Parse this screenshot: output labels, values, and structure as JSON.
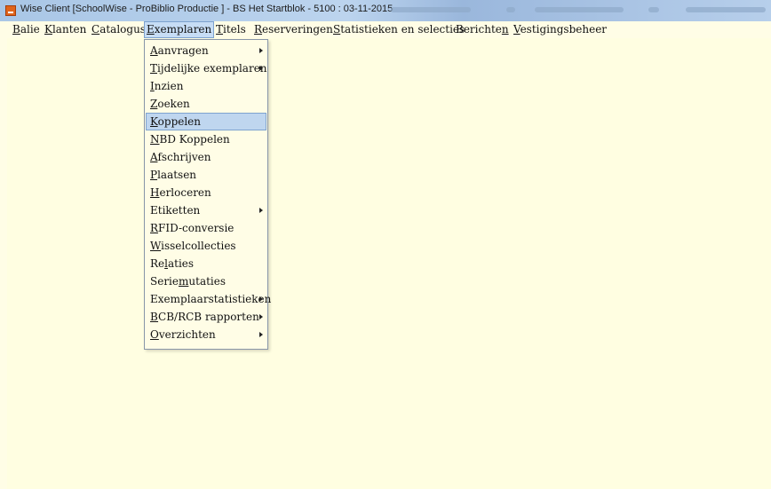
{
  "window": {
    "title": "Wise Client [SchoolWise - ProBiblio Productie ] - BS Het Startblok - 5100 : 03-11-2015"
  },
  "menubar": [
    {
      "label": "Balie",
      "key": "B",
      "rest": "alie"
    },
    {
      "label": "Klanten",
      "key": "K",
      "rest": "lanten"
    },
    {
      "label": "Catalogus",
      "key": "C",
      "rest": "atalogus"
    },
    {
      "label": "Exemplaren",
      "key": "E",
      "rest": "xemplaren",
      "active": true
    },
    {
      "label": "Titels",
      "key": "T",
      "rest": "itels"
    },
    {
      "label": "Reserveringen",
      "key": "R",
      "rest": "eserveringen"
    },
    {
      "label": "Statistieken en selecties",
      "key": "S",
      "rest": "tatistieken en selecties"
    },
    {
      "label": "Berichten",
      "pre": "Berichte",
      "key": "n",
      "rest": ""
    },
    {
      "label": "Vestigingsbeheer",
      "key": "V",
      "rest": "estigingsbeheer"
    }
  ],
  "dropdown": [
    {
      "label": "Aanvragen",
      "pre": "",
      "key": "A",
      "rest": "anvragen",
      "submenu": true
    },
    {
      "label": "Tijdelijke exemplaren",
      "pre": "",
      "key": "T",
      "rest": "ijdelijke exemplaren",
      "submenu": true
    },
    {
      "label": "Inzien",
      "pre": "",
      "key": "I",
      "rest": "nzien"
    },
    {
      "label": "Zoeken",
      "pre": "",
      "key": "Z",
      "rest": "oeken"
    },
    {
      "label": "Koppelen",
      "pre": "",
      "key": "K",
      "rest": "oppelen",
      "highlighted": true
    },
    {
      "label": "NBD Koppelen",
      "pre": "",
      "key": "N",
      "rest": "BD Koppelen"
    },
    {
      "label": "Afschrijven",
      "pre": "",
      "key": "A",
      "rest": "fschrijven"
    },
    {
      "label": "Plaatsen",
      "pre": "",
      "key": "P",
      "rest": "laatsen"
    },
    {
      "label": "Herloceren",
      "pre": "",
      "key": "H",
      "rest": "erloceren"
    },
    {
      "label": "Etiketten",
      "pre": "Etiketten",
      "key": "",
      "rest": "",
      "submenu": true
    },
    {
      "label": "RFID-conversie",
      "pre": "",
      "key": "R",
      "rest": "FID-conversie"
    },
    {
      "label": "Wisselcollecties",
      "pre": "",
      "key": "W",
      "rest": "isselcollecties"
    },
    {
      "label": "Relaties",
      "pre": "Re",
      "key": "l",
      "rest": "aties"
    },
    {
      "label": "Seriemutaties",
      "pre": "Serie",
      "key": "m",
      "rest": "utaties"
    },
    {
      "label": "Exemplaarstatistieken",
      "pre": "Exemplaarstatistieken",
      "key": "",
      "rest": "",
      "submenu": true
    },
    {
      "label": "BCB/RCB rapporten",
      "pre": "",
      "key": "B",
      "rest": "CB/RCB rapporten",
      "submenu": true
    },
    {
      "label": "Overzichten",
      "pre": "",
      "key": "O",
      "rest": "verzichten",
      "submenu": true
    }
  ]
}
